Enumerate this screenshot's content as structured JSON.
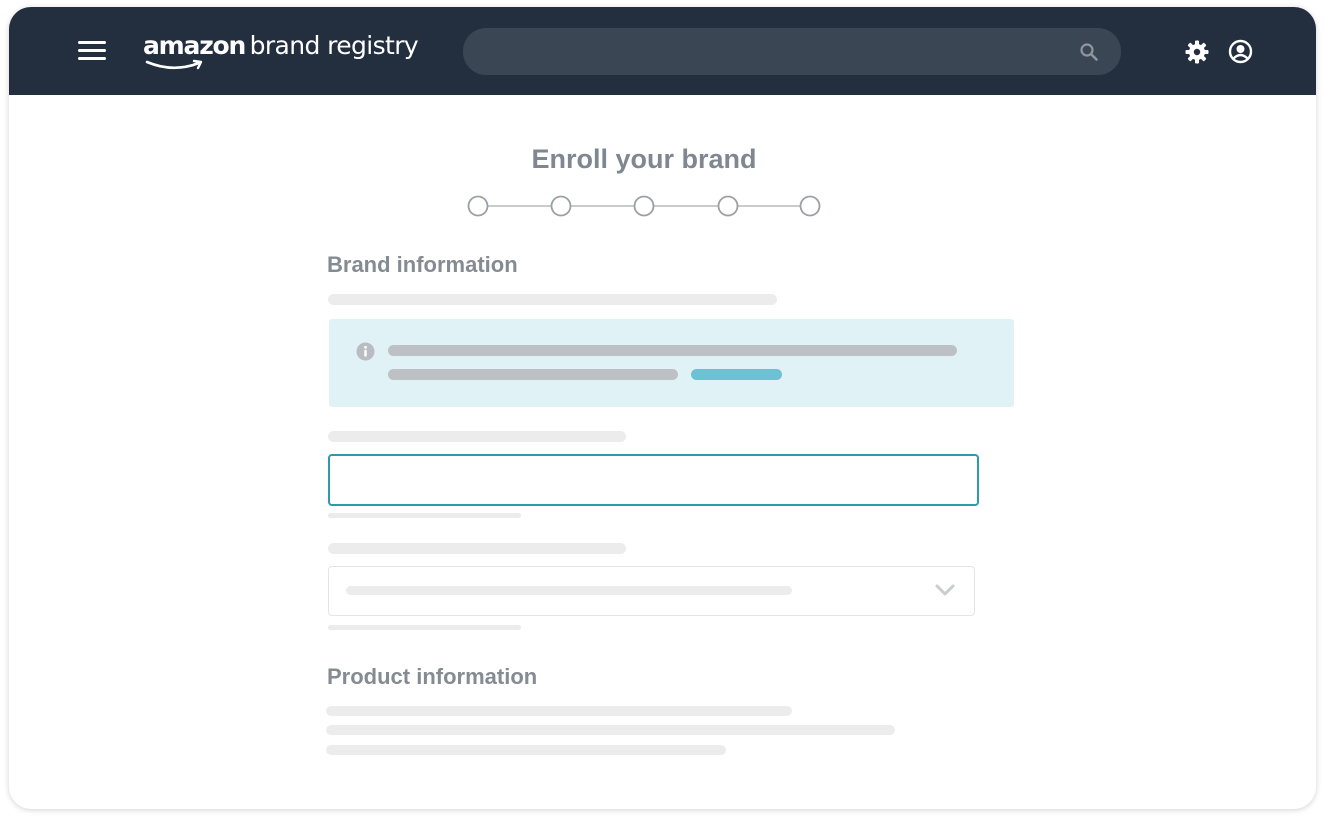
{
  "header": {
    "logo_primary": "amazon",
    "logo_secondary": "brand registry",
    "search_placeholder": "",
    "icons": [
      "menu-icon",
      "search-icon",
      "gear-icon",
      "user-icon"
    ]
  },
  "main": {
    "title": "Enroll your brand",
    "steps_count": 5,
    "sections": [
      {
        "heading": "Brand information"
      },
      {
        "heading": "Product information"
      }
    ],
    "brand_field_value": "",
    "dropdown_selected": ""
  },
  "colors": {
    "topbar": "#232f3e",
    "accent": "#2e9bad",
    "alert_bg": "#e1f2f7",
    "link": "#6cc1d3"
  }
}
